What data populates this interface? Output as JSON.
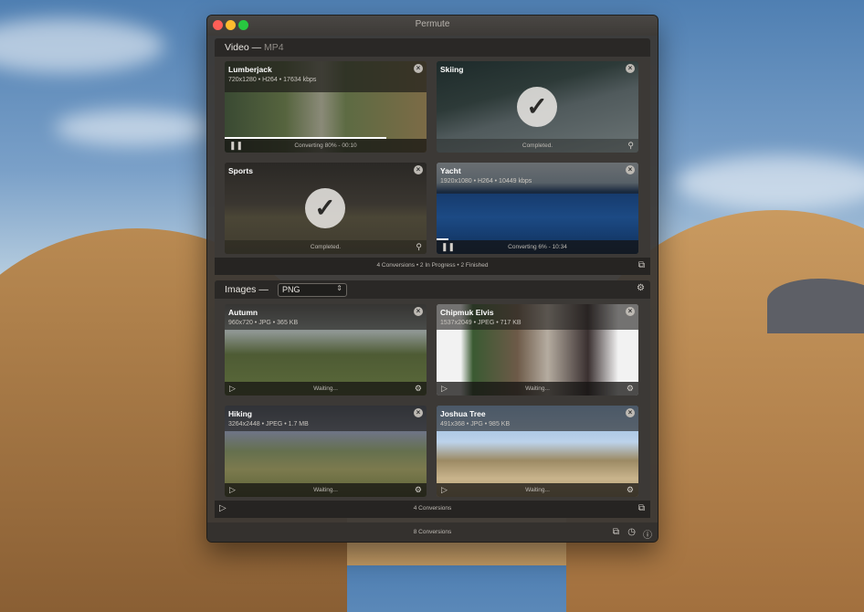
{
  "window": {
    "title": "Permute"
  },
  "video_section": {
    "label": "Video",
    "dash": "—",
    "format": "MP4",
    "footer": "4 Conversions • 2 In Progress • 2 Finished",
    "cards": [
      {
        "title": "Lumberjack",
        "info": "720x1280 • H264 • 17634 kbps",
        "status": "Converting 80% - 00:10",
        "progress": 0.8,
        "state": "converting"
      },
      {
        "title": "Skiing",
        "info": "",
        "status": "Completed.",
        "progress": 1.0,
        "state": "completed"
      },
      {
        "title": "Sports",
        "info": "",
        "status": "Completed.",
        "progress": 1.0,
        "state": "completed"
      },
      {
        "title": "Yacht",
        "info": "1920x1080 • H264 • 10449 kbps",
        "status": "Converting 6% - 10:34",
        "progress": 0.06,
        "state": "converting"
      }
    ]
  },
  "images_section": {
    "label": "Images",
    "dash": "—",
    "format": "PNG",
    "footer": "4 Conversions",
    "cards": [
      {
        "title": "Autumn",
        "info": "960x720 • JPG • 365 KB",
        "status": "Waiting...",
        "state": "waiting"
      },
      {
        "title": "Chipmuk Elvis",
        "info": "1537x2049 • JPEG • 717 KB",
        "status": "Waiting...",
        "state": "waiting"
      },
      {
        "title": "Hiking",
        "info": "3264x2448 • JPEG • 1.7 MB",
        "status": "Waiting...",
        "state": "waiting"
      },
      {
        "title": "Joshua Tree",
        "info": "491x368 • JPG • 985 KB",
        "status": "Waiting...",
        "state": "waiting"
      }
    ]
  },
  "bottom_bar": {
    "text": "8 Conversions"
  },
  "icons": {
    "close": "close-icon",
    "pause": "pause-icon",
    "play": "play-icon",
    "gear": "gear-icon",
    "search": "search-icon",
    "check": "checkmark-icon",
    "preview": "preview-icon",
    "clock": "clock-icon",
    "info": "info-icon"
  },
  "colors": {
    "traffic_close": "#ff5f57",
    "traffic_min": "#febc2e",
    "traffic_max": "#28c840"
  }
}
